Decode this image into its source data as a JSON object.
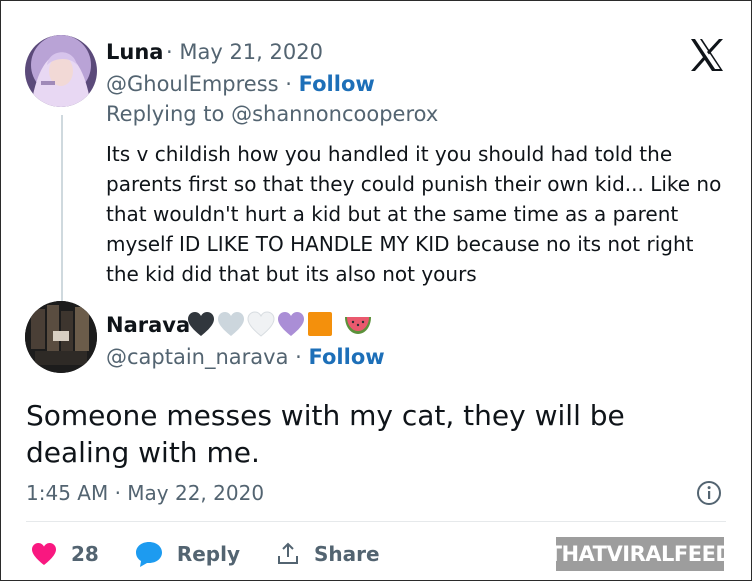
{
  "reply_tweet": {
    "author_name": "Luna",
    "date": "· May 21, 2020",
    "handle": "@GhoulEmpress",
    "separator": " · ",
    "follow_label": "Follow",
    "replying_to": "Replying to @shannoncooperox",
    "text": "Its v childish how you handled it you should had told the parents first so that they could punish their own kid... Like no that wouldn't hurt a kid but at the same time as a parent myself ID LIKE TO HANDLE MY KID because no its not right the kid did that but its also not yours"
  },
  "main_tweet": {
    "author_name": "Narava",
    "name_emojis": [
      "black-heart",
      "grey-heart",
      "white-heart",
      "purple-heart",
      "orange-square",
      "watermelon"
    ],
    "handle": "@captain_narava",
    "separator": " · ",
    "follow_label": "Follow",
    "text": "Someone messes with my cat, they will be dealing with me.",
    "timestamp": "1:45 AM · May 22, 2020",
    "likes_count": "28",
    "reply_label": "Reply",
    "share_label": "Share"
  },
  "watermark": "THATVIRALFEED",
  "colors": {
    "link_blue": "#1d6fb8",
    "like_pink": "#f91880",
    "reply_blue": "#1d9bf0",
    "muted_text": "#536471",
    "watermark_bg": "#9d9d9d"
  }
}
